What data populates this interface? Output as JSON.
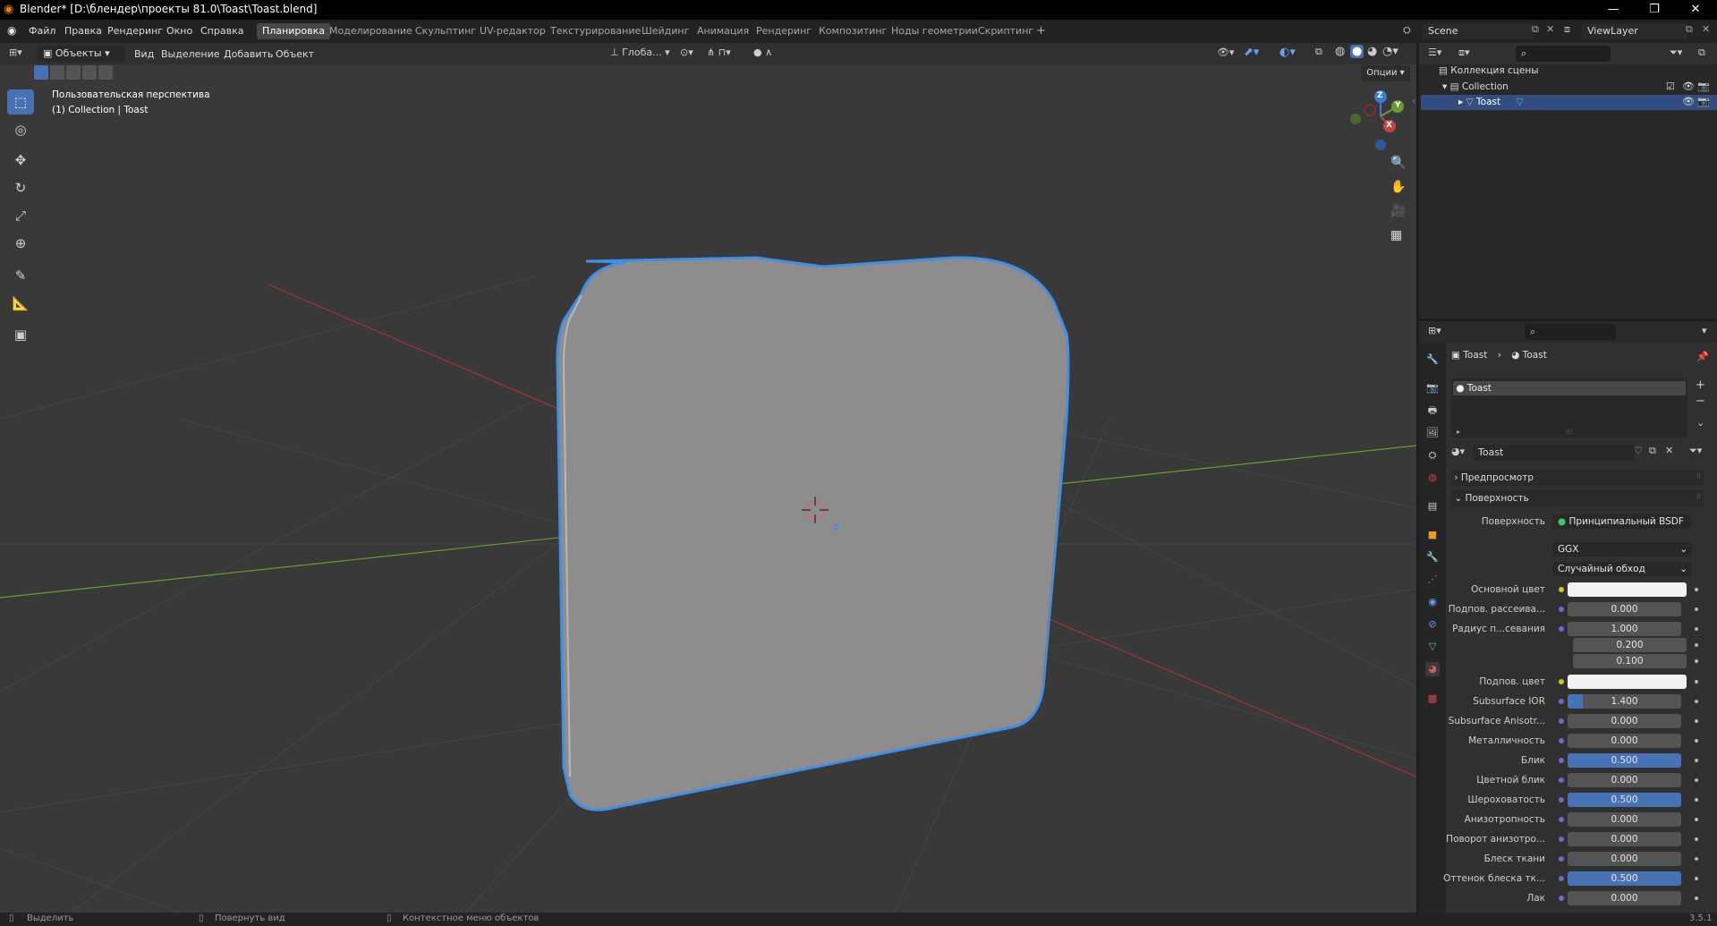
{
  "window": {
    "title": "Blender* [D:\\блендер\\проекты 81.0\\Toast\\Toast.blend]",
    "min": "—",
    "restore": "❐",
    "close": "✕"
  },
  "menu": [
    "Файл",
    "Правка",
    "Рендеринг",
    "Окно",
    "Справка"
  ],
  "workspaces": [
    "Планировка",
    "Моделирование",
    "Скульптинг",
    "UV-редактор",
    "Текстурирование",
    "Шейдинг",
    "Анимация",
    "Рендеринг",
    "Композитинг",
    "Ноды геометрии",
    "Скриптинг",
    "+"
  ],
  "scene": {
    "name": "Scene",
    "view_layer": "ViewLayer"
  },
  "viewport": {
    "mode": "Объекты",
    "menus": [
      "Вид",
      "Выделение",
      "Добавить",
      "Объект"
    ],
    "orientation": "Глоба...",
    "options": "Опции",
    "overlay_title": "Пользовательская перспектива",
    "overlay_sub": "(1) Collection | Toast",
    "gizmo": {
      "z": "Z",
      "y": "Y",
      "x": "X"
    }
  },
  "outliner": {
    "root": "Коллекция сцены",
    "collection": "Collection",
    "object": "Toast"
  },
  "properties": {
    "breadcrumb": [
      "Toast",
      "Toast"
    ],
    "slot": "Toast",
    "material_name": "Toast",
    "panel_preview": "Предпросмотр",
    "panel_surface": "Поверхность",
    "surface_label": "Поверхность",
    "surface_value": "Принципиальный BSDF",
    "distribution": "GGX",
    "subsurface_method": "Случайный обход",
    "rows": [
      {
        "label": "Основной цвет",
        "type": "color",
        "value": "",
        "dot": "#c9c92a"
      },
      {
        "label": "Подпов. рассеива...",
        "type": "num",
        "value": "0.000",
        "fill": 0,
        "dot": "#6a6ad0"
      },
      {
        "label": "Радиус п...севания",
        "type": "num",
        "value": "1.000",
        "fill": 0,
        "dot": "#6a6ad0"
      },
      {
        "label": "",
        "type": "num",
        "value": "0.200",
        "fill": 0,
        "dot": ""
      },
      {
        "label": "",
        "type": "num",
        "value": "0.100",
        "fill": 0,
        "dot": ""
      },
      {
        "label": "Подпов. цвет",
        "type": "color",
        "value": "",
        "dot": "#c9c92a"
      },
      {
        "label": "Subsurface IOR",
        "type": "num",
        "value": "1.400",
        "fill": 0.13,
        "dot": "#6a6ad0"
      },
      {
        "label": "Subsurface Anisotr...",
        "type": "num",
        "value": "0.000",
        "fill": 0,
        "dot": "#6a6ad0"
      },
      {
        "label": "Металличность",
        "type": "num",
        "value": "0.000",
        "fill": 0,
        "dot": "#6a6ad0"
      },
      {
        "label": "Блик",
        "type": "num",
        "value": "0.500",
        "fill": 1.0,
        "dot": "#6a6ad0"
      },
      {
        "label": "Цветной блик",
        "type": "num",
        "value": "0.000",
        "fill": 0,
        "dot": "#6a6ad0"
      },
      {
        "label": "Шероховатость",
        "type": "num",
        "value": "0.500",
        "fill": 1.0,
        "dot": "#6a6ad0"
      },
      {
        "label": "Анизотропность",
        "type": "num",
        "value": "0.000",
        "fill": 0,
        "dot": "#6a6ad0"
      },
      {
        "label": "Поворот анизотро...",
        "type": "num",
        "value": "0.000",
        "fill": 0,
        "dot": "#6a6ad0"
      },
      {
        "label": "Блеск ткани",
        "type": "num",
        "value": "0.000",
        "fill": 0,
        "dot": "#6a6ad0"
      },
      {
        "label": "Оттенок блеска тк...",
        "type": "num",
        "value": "0.500",
        "fill": 1.0,
        "dot": "#6a6ad0"
      },
      {
        "label": "Лак",
        "type": "num",
        "value": "0.000",
        "fill": 0,
        "dot": "#6a6ad0"
      }
    ]
  },
  "statusbar": {
    "select": "Выделить",
    "rotate": "Повернуть вид",
    "context": "Контекстное меню объектов",
    "version": "3.5.1"
  },
  "colors": {
    "accent": "#4772b3",
    "selection_outline": "#3d8fe8",
    "x_axis": "#a03535",
    "y_axis": "#6b9a30"
  }
}
